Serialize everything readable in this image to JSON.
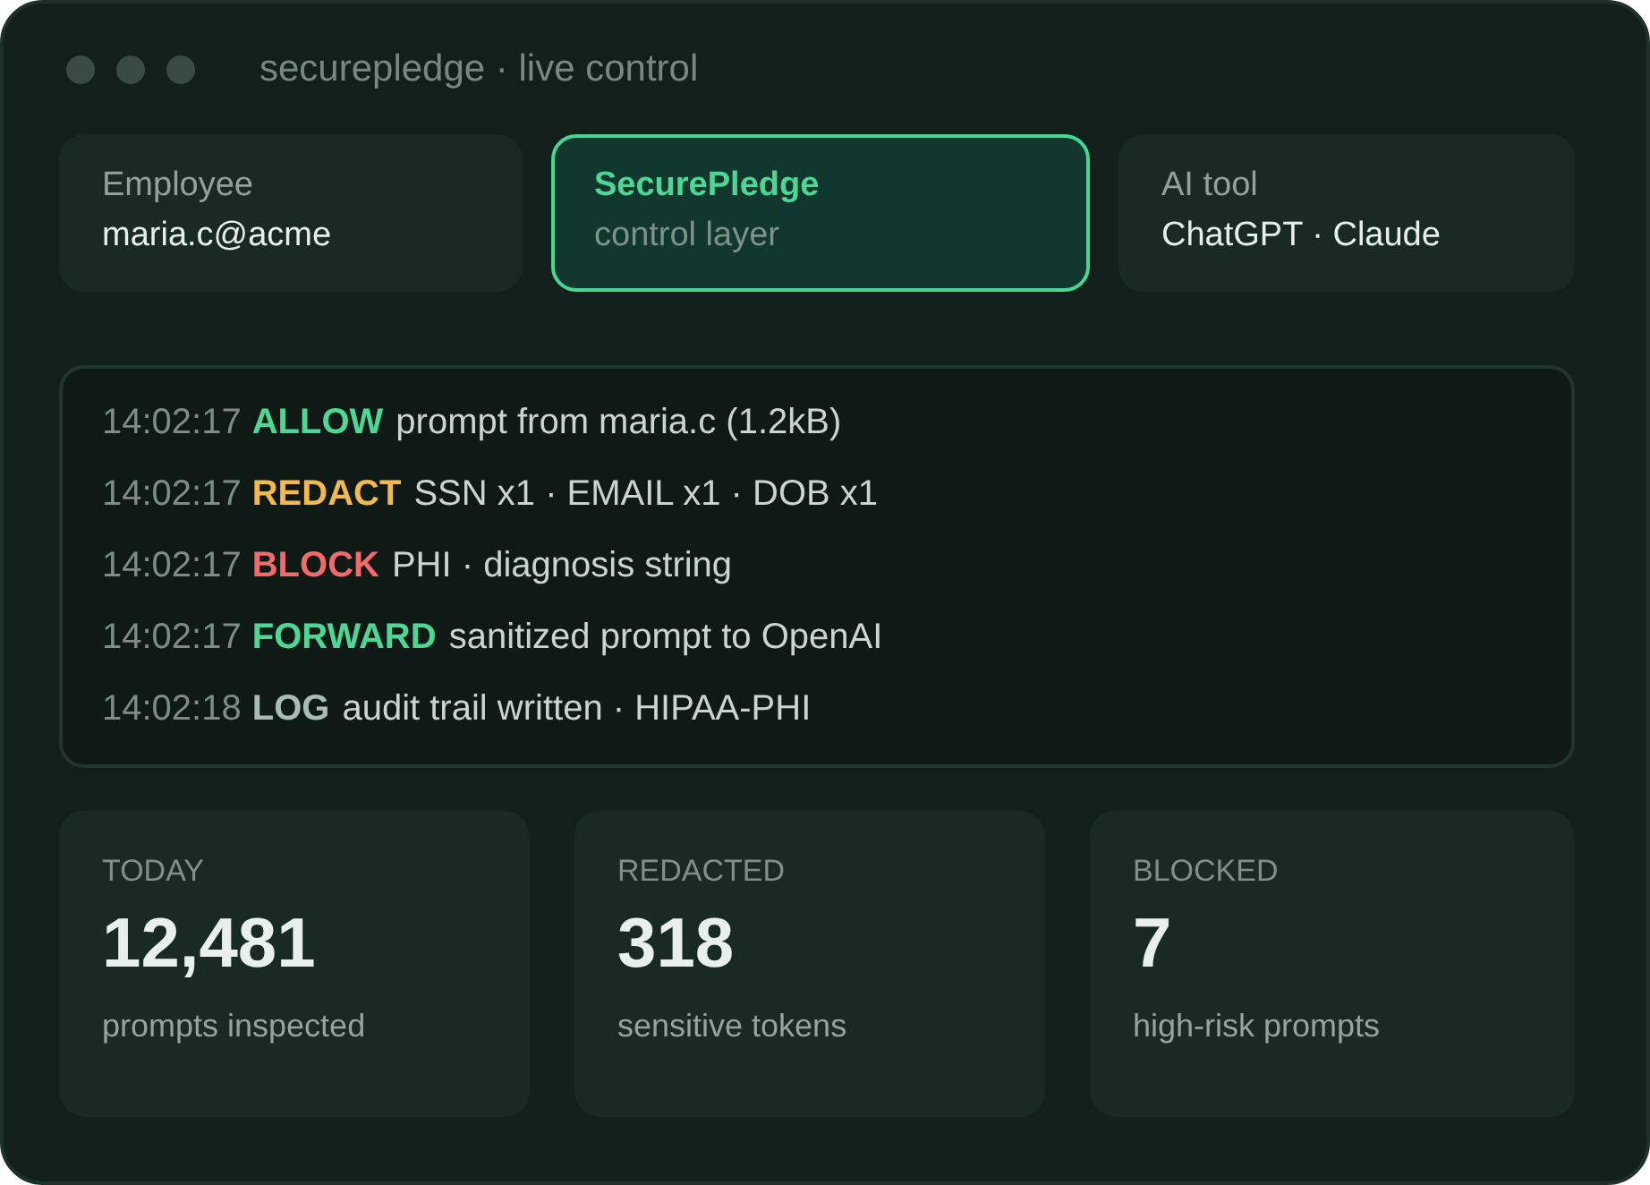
{
  "window": {
    "title": "securepledge · live control"
  },
  "nodes": [
    {
      "label": "Employee",
      "value": "maria.c@acme",
      "selected": false
    },
    {
      "label": "SecurePledge",
      "value": "control layer",
      "selected": true
    },
    {
      "label": "AI tool",
      "value": "ChatGPT · Claude",
      "selected": false
    }
  ],
  "log": [
    {
      "time": "14:02:17",
      "action": "ALLOW",
      "message": "prompt from maria.c (1.2kB)",
      "color": "#4cd894"
    },
    {
      "time": "14:02:17",
      "action": "REDACT",
      "message": "SSN x1 · EMAIL x1 · DOB x1",
      "color": "#f2b94c"
    },
    {
      "time": "14:02:17",
      "action": "BLOCK",
      "message": "PHI · diagnosis string",
      "color": "#f26a6a"
    },
    {
      "time": "14:02:17",
      "action": "FORWARD",
      "message": "sanitized prompt to OpenAI",
      "color": "#4cd894"
    },
    {
      "time": "14:02:18",
      "action": "LOG",
      "message": "audit trail written · HIPAA-PHI",
      "color": "#a9bcb3"
    }
  ],
  "stats": [
    {
      "label": "TODAY",
      "value": "12,481",
      "caption": "prompts inspected"
    },
    {
      "label": "REDACTED",
      "value": "318",
      "caption": "sensitive tokens"
    },
    {
      "label": "BLOCKED",
      "value": "7",
      "caption": "high-risk prompts"
    }
  ]
}
